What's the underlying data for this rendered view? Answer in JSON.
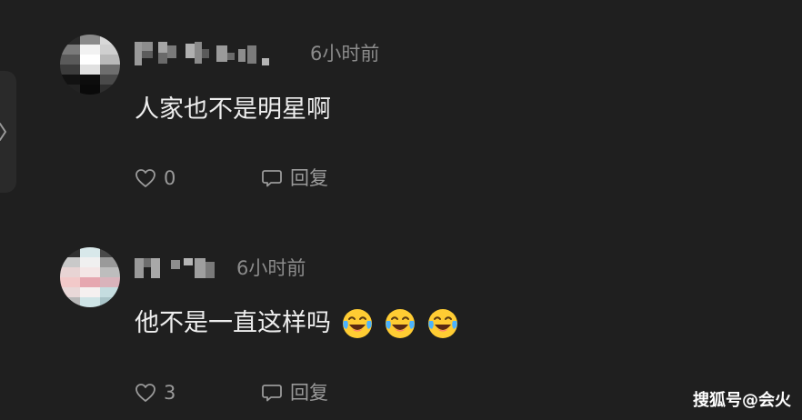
{
  "comments": [
    {
      "username": "",
      "time": "6小时前",
      "text": "人家也不是明星啊",
      "emojis": [],
      "likes": "0",
      "reply_label": "回复"
    },
    {
      "username": "",
      "time": "6小时前",
      "text": "他不是一直这样吗",
      "emojis": [
        "crying-laughing",
        "crying-laughing",
        "crying-laughing"
      ],
      "likes": "3",
      "reply_label": "回复"
    }
  ],
  "watermark": "搜狐号@会火",
  "colors": {
    "background": "#1f1f1f",
    "meta_text": "#8b8b8b",
    "body_text": "#ededed"
  },
  "icons": [
    "chevron-right-icon",
    "heart-icon",
    "comment-bubble-icon",
    "crying-laughing-emoji"
  ]
}
